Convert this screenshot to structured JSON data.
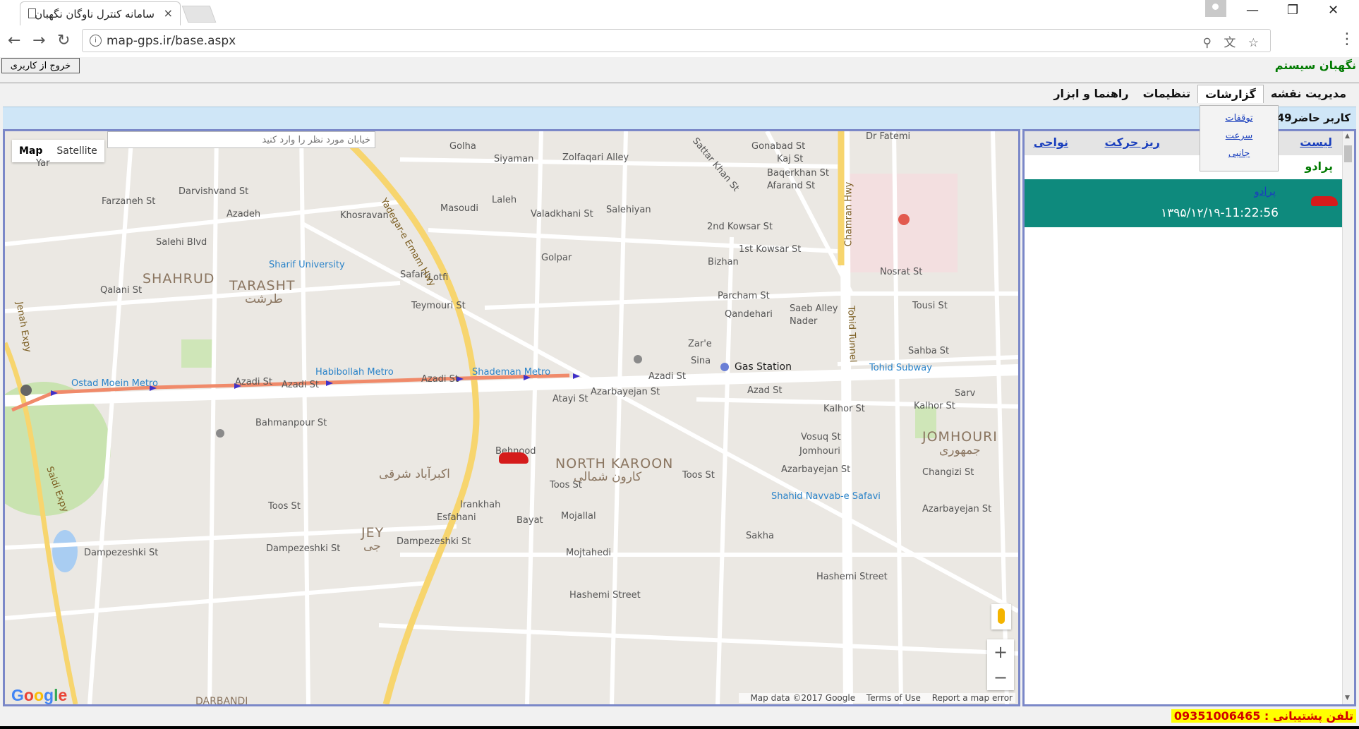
{
  "browser": {
    "tab_title": "سامانه کنترل ناوگان نگهبان",
    "tab_close": "×",
    "url": "map-gps.ir/base.aspx",
    "window_min": "—",
    "window_restore": "❐",
    "window_close": "✕",
    "back": "←",
    "forward": "→",
    "reload": "↻",
    "menu": "⋮",
    "omni_icons": "⚲ 文 ☆"
  },
  "header": {
    "logout_label": "خروج از کاربری",
    "site_name": "نگهبان سیستم"
  },
  "menu": {
    "items": [
      "مدیریت نقشه",
      "گزارشات",
      "تنظیمات",
      "راهنما و ابزار"
    ],
    "active": "گزارشات",
    "dropdown": [
      "توقفات",
      "سرعت",
      "جانبی"
    ]
  },
  "userbar": {
    "text": "کاربر حاضر0249 ۱۳۹۵/۵/۱"
  },
  "map": {
    "type_map": "Map",
    "type_satellite": "Satellite",
    "search_placeholder": "خیابان مورد نظر را وارد کنید",
    "zoom_in": "+",
    "zoom_out": "−",
    "google": "Google",
    "footer": {
      "data": "Map data ©2017 Google",
      "terms": "Terms of Use",
      "report": "Report a map error"
    },
    "labels": {
      "golha": "Golha",
      "siyaman": "Siyaman",
      "zolfaqari": "Zolfaqari Alley",
      "gonabad": "Gonabad St",
      "kaj": "Kaj St",
      "baqerkhan": "Baqerkhan St",
      "afarand": "Afarand St",
      "darvishvand": "Darvishvand St",
      "farzaneh": "Farzaneh St",
      "azadeh": "Azadeh",
      "khosravan": "Khosravan",
      "masoudi": "Masoudi",
      "laleh": "Laleh",
      "valadkhani": "Valadkhani St",
      "salehiyan": "Salehiyan",
      "kowsar2": "2nd Kowsar St",
      "kowsar1": "1st Kowsar St",
      "bizhan": "Bizhan",
      "salehi_blvd": "Salehi Blvd",
      "sharif": "Sharif University",
      "safari": "Safari",
      "lotfi": "Lotfi",
      "golpar": "Golpar",
      "nosrat": "Nosrat St",
      "parcham": "Parcham St",
      "qandehari": "Qandehari",
      "saeb": "Saeb Alley",
      "nader": "Nader",
      "tousi": "Tousi St",
      "qalani": "Qalani St",
      "teymouri": "Teymouri St",
      "zare": "Zar'e",
      "sina": "Sina",
      "sahba": "Sahba St",
      "azadi1": "Azadi St",
      "azadi2": "Azadi St",
      "azadi3": "Azadi St",
      "azadi4": "Azadi St",
      "azad": "Azad St",
      "kalhor1": "Kalhor St",
      "kalhor2": "Kalhor St",
      "sarv": "Sarv",
      "atayi": "Atayi St",
      "bahmanpour": "Bahmanpour St",
      "behnood": "Behnood",
      "vosuq": "Vosuq St",
      "jomhouri": "Jomhouri",
      "changizi": "Changizi St",
      "toos1": "Toos St",
      "toos2": "Toos St",
      "toos3": "Toos St",
      "irankhah": "Irankhah",
      "bayat": "Bayat",
      "mojallal": "Mojallal",
      "esfahani": "Esfahani",
      "azarbayejan1": "Azarbayejan St",
      "azarbayejan2": "Azarbayejan St",
      "azarbayejan3": "Azarbayejan St",
      "dampezeshki1": "Dampezeshki St",
      "dampezeshki2": "Dampezeshki St",
      "dampezeshki3": "Dampezeshki St",
      "mojtahedi": "Mojtahedi",
      "sakha": "Sakha",
      "hashemi": "Hashemi Street",
      "hashemi2": "Hashemi Street",
      "gas_station": "Gas Station",
      "yadegar": "Yadegar-e Emam Hwy",
      "chamran": "Chamran Hwy",
      "tohid": "Tohid Tunnel",
      "jenah": "Jenah Expy",
      "saidi": "Saidi Expy",
      "sattarkhan": "Sattar Khan St",
      "drfatemi": "Dr Fatemi",
      "yar": "Yar",
      "darbandi": "DARBANDI"
    },
    "metros": {
      "ostad_moein": "Ostad Moein Metro",
      "habibollah": "Habibollah Metro",
      "shademan": "Shademan Metro",
      "tohid_subway": "Tohid Subway",
      "navvab": "Shahid Navvab-e Safavi"
    },
    "areas": {
      "shahrud": "SHAHRUD",
      "tarasht": "TARASHT",
      "tarasht_fa": "طرشت",
      "north_karoon": "NORTH KAROON",
      "north_karoon_fa": "کارون شمالی",
      "jomhouri": "JOMHOURI",
      "jomhouri_fa": "جمهوری",
      "jey": "JEY",
      "jey_fa": "جی",
      "ekbatan_fa": "اکبرآباد شرقی"
    }
  },
  "panel": {
    "tab_list": "لیست",
    "tab_detail": "ریز حرکت",
    "tab_areas": "نواحی",
    "vehicle_heading": "پرادو",
    "vehicle_name": "پرادو",
    "vehicle_time": "۱۳۹۵/۱۲/۱۹-11:22:56"
  },
  "footer": {
    "support": "تلفن پشتیبانی : 09351006465"
  },
  "colors": {
    "menu_accent": "#007a00",
    "route": "#f08a6a",
    "vehicle_bar": "#0e8a7d"
  }
}
